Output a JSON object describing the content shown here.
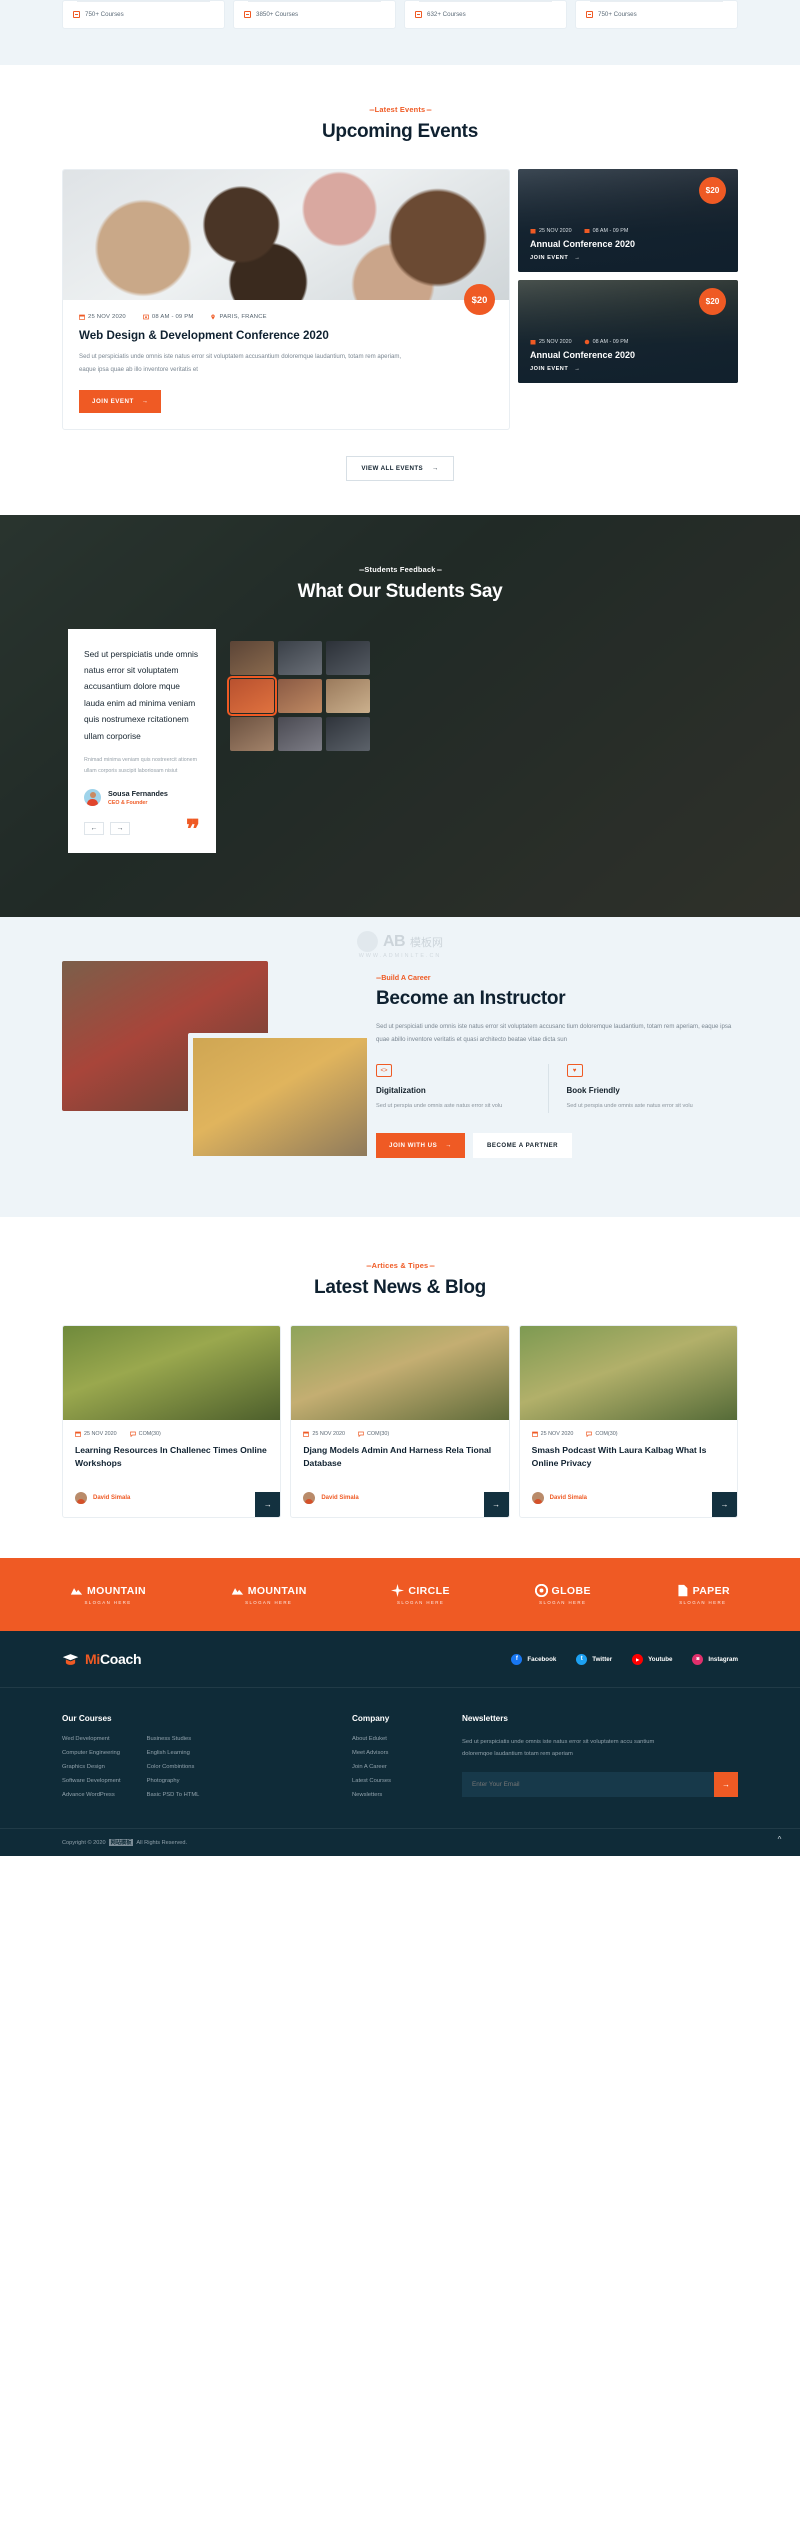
{
  "top_courses": [
    {
      "label": "750+ Courses"
    },
    {
      "label": "3850+ Courses"
    },
    {
      "label": "632+ Courses"
    },
    {
      "label": "750+ Courses"
    }
  ],
  "events": {
    "kicker": "Latest Events",
    "title": "Upcoming Events",
    "main": {
      "date": "25 NOV 2020",
      "time": "08 AM - 09 PM",
      "location": "PARIS, FRANCE",
      "title": "Web Design & Development Conference 2020",
      "desc": "Sed ut perspiciatis unde omnis iste natus error sit voluptatem accusantium doloremque laudantium, totam rem aperiam, eaque ipsa quae ab illo inventore veritatis et",
      "cta": "JOIN EVENT",
      "price": "$20"
    },
    "side": [
      {
        "date": "25 NOV 2020",
        "time": "08 AM - 09 PM",
        "title": "Annual Conference 2020",
        "cta": "JOIN EVENT",
        "price": "$20"
      },
      {
        "date": "25 NOV 2020",
        "time": "08 AM - 09 PM",
        "title": "Annual Conference 2020",
        "cta": "JOIN EVENT",
        "price": "$20"
      }
    ],
    "view_all": "VIEW ALL EVENTS"
  },
  "testimonials": {
    "kicker": "Students Feedback",
    "title": "What Our Students Say",
    "quote": "Sed ut perspiciatis unde omnis natus error sit voluptatem accusantium dolore mque lauda enim ad minima veniam quis nostrumexe rcitationem ullam corporise",
    "sub": "Rnimad minima veniam quis nostreercit ationem ullam corporis suscipit laboriosam nisiut",
    "name": "Sousa Fernandes",
    "role": "CEO & Founder",
    "prev": "←",
    "next": "→"
  },
  "instructor": {
    "kicker": "Build A Career",
    "title": "Become an Instructor",
    "desc": "Sed ut perspiciati unde omnis iste natus error sit voluptatem accusanc tium doloremque laudantium, totam rem aperiam, eaque ipsa quae abillo inventore veritatis et quasi architecto beatae vitae dicta sun",
    "features": [
      {
        "title": "Digitalization",
        "desc": "Sed ut perspia unde omnis aste natus error sit volu",
        "icon": "code-icon"
      },
      {
        "title": "Book Friendly",
        "desc": "Sed ut perspia unde omnis aste natus error sit volu",
        "icon": "book-heart-icon"
      }
    ],
    "cta_primary": "JOIN WITH US",
    "cta_secondary": "BECOME A PARTNER"
  },
  "watermark": {
    "ab": "AB",
    "cn": "模板网",
    "sub": "WWW.ADMINLTE.CN"
  },
  "blog": {
    "kicker": "Artices & Tipes",
    "title": "Latest News & Blog",
    "posts": [
      {
        "date": "25 NOV 2020",
        "comments": "COM(30)",
        "title": "Learning Resources In Challenec Times Online Workshops",
        "author": "David Simala"
      },
      {
        "date": "25 NOV 2020",
        "comments": "COM(30)",
        "title": "Djang Models Admin And Harness Rela Tional Database",
        "author": "David Simala"
      },
      {
        "date": "25 NOV 2020",
        "comments": "COM(30)",
        "title": "Smash Podcast With Laura Kalbag What Is Online Privacy",
        "author": "David Simala"
      }
    ]
  },
  "brands": [
    {
      "name": "MOUNTAIN",
      "sub": "SLOGAN HERE",
      "icon": "mountain-icon"
    },
    {
      "name": "MOUNTAIN",
      "sub": "SLOGAN HERE",
      "icon": "mountain-icon"
    },
    {
      "name": "CIRCLE",
      "sub": "SLOGAN HERE",
      "icon": "star-icon"
    },
    {
      "name": "GLOBE",
      "sub": "SLOGAN HERE",
      "icon": "globe-icon"
    },
    {
      "name": "PAPER",
      "sub": "SLOGAN HERE",
      "icon": "paper-icon"
    }
  ],
  "footer": {
    "logo": "MiCoach",
    "logo_accent": "Mi",
    "logo_rest": "Coach",
    "socials": [
      {
        "label": "Facebook",
        "glyph": "f",
        "color": "#1877f2"
      },
      {
        "label": "Twitter",
        "glyph": "t",
        "color": "#1da1f2"
      },
      {
        "label": "Youtube",
        "glyph": "▶",
        "color": "#ff0000"
      },
      {
        "label": "Instagram",
        "glyph": "◙",
        "color": "#e1306c"
      }
    ],
    "courses": {
      "heading": "Our Courses",
      "col1": [
        "Wed Development",
        "Computer Engineering",
        "Graphics Design",
        "Software Development",
        "Advance WordPress"
      ],
      "col2": [
        "Business Studies",
        "English Learning",
        "Color Combintions",
        "Photography",
        "Basic PSD To HTML"
      ]
    },
    "company": {
      "heading": "Company",
      "links": [
        "About Eduket",
        "Meet Advisors",
        "Join A Career",
        "Latest Courses",
        "Newsletters"
      ]
    },
    "newsletters": {
      "heading": "Newsletters",
      "desc": "Sed ut perspiciatis unde omnis iste natus error sit voluptatem accu santium doloremqoe laudantium totam rem aperiam",
      "placeholder": "Enter Your Email",
      "submit": "→"
    },
    "copyright_pre": "Copyright © 2020",
    "copyright_badge": "网站模板",
    "copyright_post": "All Rights Reserved."
  },
  "colors": {
    "accent": "#ef5a24",
    "dark": "#0f2b38",
    "light_bg": "#eef4f8"
  }
}
